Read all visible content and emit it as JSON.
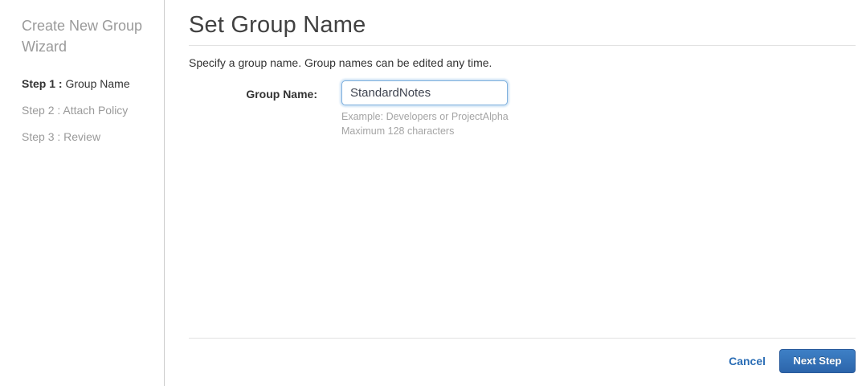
{
  "sidebar": {
    "title": "Create New Group Wizard",
    "steps": [
      {
        "prefix": "Step 1 :",
        "label": " Group Name",
        "active": true
      },
      {
        "prefix": "Step 2 :",
        "label": " Attach Policy",
        "active": false
      },
      {
        "prefix": "Step 3 :",
        "label": " Review",
        "active": false
      }
    ]
  },
  "main": {
    "title": "Set Group Name",
    "description": "Specify a group name. Group names can be edited any time.",
    "form": {
      "label": "Group Name:",
      "value": "StandardNotes",
      "hint_line1": "Example: Developers or ProjectAlpha",
      "hint_line2": "Maximum 128 characters"
    },
    "footer": {
      "cancel_label": "Cancel",
      "next_label": "Next Step"
    }
  },
  "colors": {
    "link_blue": "#2a6db5",
    "button_gradient_top": "#3e80c6",
    "button_gradient_bottom": "#2c65ab",
    "button_border": "#2b5c9c",
    "input_focus_border": "#7fb0dd",
    "inactive_text": "#9a9a9a",
    "divider": "#e2e2e2"
  }
}
